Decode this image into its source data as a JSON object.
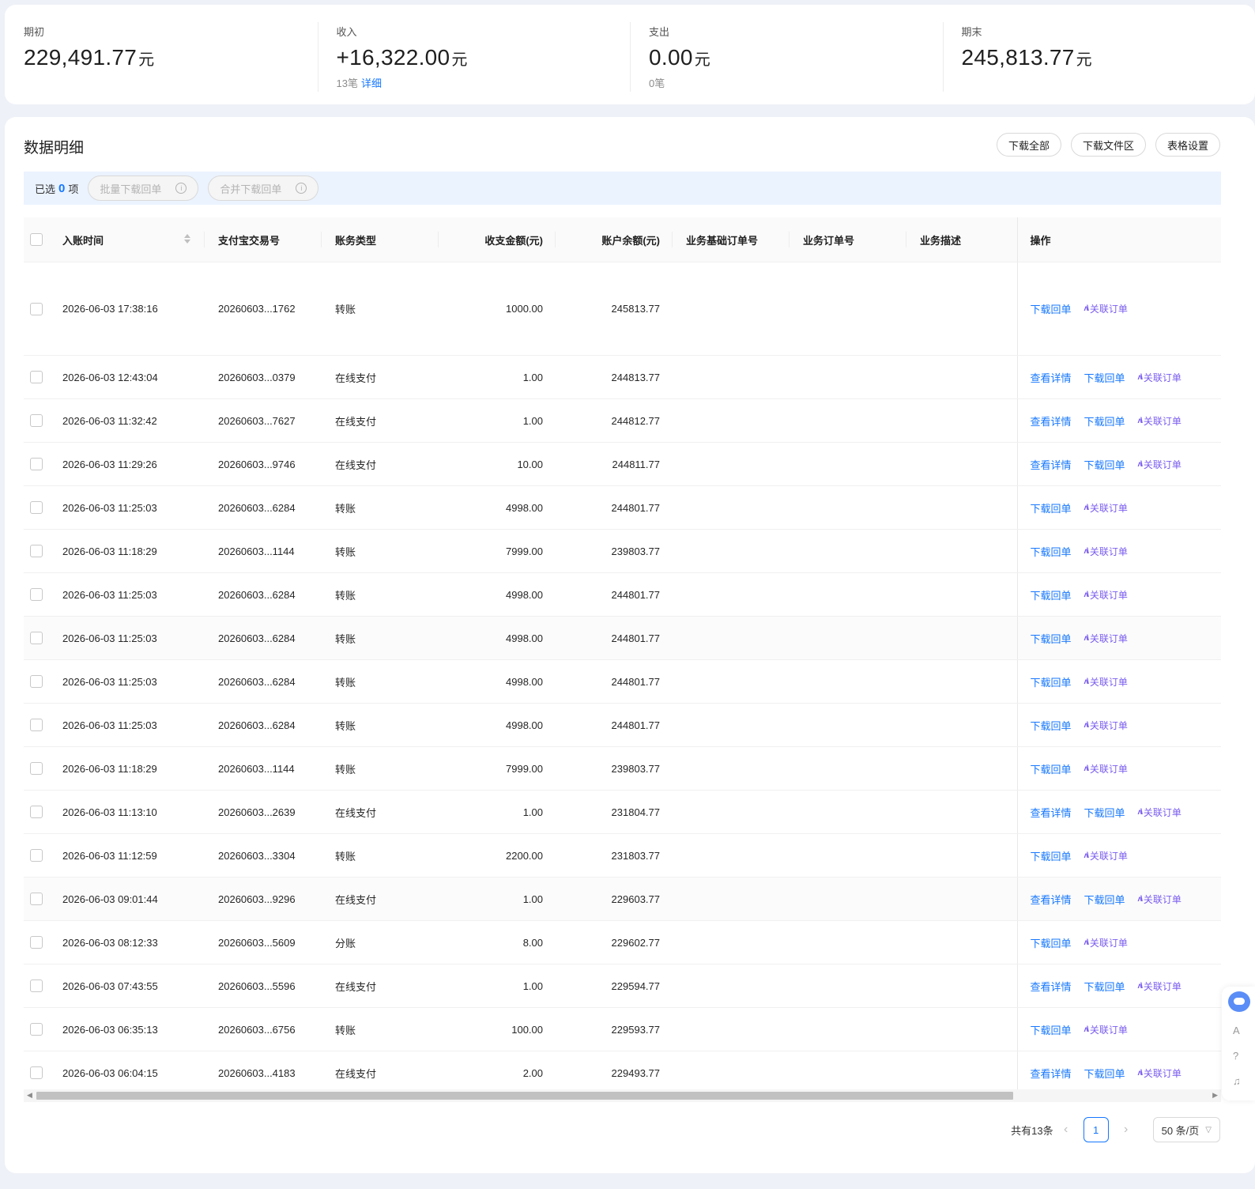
{
  "summary": {
    "opening": {
      "label": "期初",
      "value": "229,491.77",
      "unit": "元"
    },
    "income": {
      "label": "收入",
      "value": "+16,322.00",
      "unit": "元",
      "count": "13笔",
      "detail": "详细"
    },
    "expense": {
      "label": "支出",
      "value": "0.00",
      "unit": "元",
      "count": "0笔"
    },
    "closing": {
      "label": "期末",
      "value": "245,813.77",
      "unit": "元"
    }
  },
  "panel": {
    "title": "数据明细",
    "buttons": {
      "download_all": "下载全部",
      "download_area": "下载文件区",
      "table_settings": "表格设置"
    }
  },
  "selection": {
    "prefix": "已选",
    "count": "0",
    "suffix": "项",
    "batch_download": "批量下载回单",
    "merge_download": "合并下载回单"
  },
  "table": {
    "headers": {
      "time": "入账时间",
      "trade_no": "支付宝交易号",
      "type": "账务类型",
      "amount": "收支金额(元)",
      "balance": "账户余额(元)",
      "base_order": "业务基础订单号",
      "order": "业务订单号",
      "desc": "业务描述",
      "ops": "操作"
    },
    "actions": {
      "view": "查看详情",
      "download": "下载回单",
      "link": "关联订单"
    },
    "rows": [
      {
        "time": "2026-06-03 17:38:16",
        "trade_no": "20260603...1762",
        "type": "转账",
        "amount": "1000.00",
        "balance": "245813.77",
        "view": ""
      },
      {
        "time": "2026-06-03 12:43:04",
        "trade_no": "20260603...0379",
        "type": "在线支付",
        "amount": "1.00",
        "balance": "244813.77",
        "view": "查看详情"
      },
      {
        "time": "2026-06-03 11:32:42",
        "trade_no": "20260603...7627",
        "type": "在线支付",
        "amount": "1.00",
        "balance": "244812.77",
        "view": "查看详情"
      },
      {
        "time": "2026-06-03 11:29:26",
        "trade_no": "20260603...9746",
        "type": "在线支付",
        "amount": "10.00",
        "balance": "244811.77",
        "view": "查看详情"
      },
      {
        "time": "2026-06-03 11:25:03",
        "trade_no": "20260603...6284",
        "type": "转账",
        "amount": "4998.00",
        "balance": "244801.77",
        "view": ""
      },
      {
        "time": "2026-06-03 11:18:29",
        "trade_no": "20260603...1144",
        "type": "转账",
        "amount": "7999.00",
        "balance": "239803.77",
        "view": ""
      },
      {
        "time": "2026-06-03 11:25:03",
        "trade_no": "20260603...6284",
        "type": "转账",
        "amount": "4998.00",
        "balance": "244801.77",
        "view": ""
      },
      {
        "time": "2026-06-03 11:25:03",
        "trade_no": "20260603...6284",
        "type": "转账",
        "amount": "4998.00",
        "balance": "244801.77",
        "view": ""
      },
      {
        "time": "2026-06-03 11:25:03",
        "trade_no": "20260603...6284",
        "type": "转账",
        "amount": "4998.00",
        "balance": "244801.77",
        "view": ""
      },
      {
        "time": "2026-06-03 11:25:03",
        "trade_no": "20260603...6284",
        "type": "转账",
        "amount": "4998.00",
        "balance": "244801.77",
        "view": ""
      },
      {
        "time": "2026-06-03 11:18:29",
        "trade_no": "20260603...1144",
        "type": "转账",
        "amount": "7999.00",
        "balance": "239803.77",
        "view": ""
      },
      {
        "time": "2026-06-03 11:13:10",
        "trade_no": "20260603...2639",
        "type": "在线支付",
        "amount": "1.00",
        "balance": "231804.77",
        "view": "查看详情"
      },
      {
        "time": "2026-06-03 11:12:59",
        "trade_no": "20260603...3304",
        "type": "转账",
        "amount": "2200.00",
        "balance": "231803.77",
        "view": ""
      },
      {
        "time": "2026-06-03 09:01:44",
        "trade_no": "20260603...9296",
        "type": "在线支付",
        "amount": "1.00",
        "balance": "229603.77",
        "view": "查看详情"
      },
      {
        "time": "2026-06-03 08:12:33",
        "trade_no": "20260603...5609",
        "type": "分账",
        "amount": "8.00",
        "balance": "229602.77",
        "view": ""
      },
      {
        "time": "2026-06-03 07:43:55",
        "trade_no": "20260603...5596",
        "type": "在线支付",
        "amount": "1.00",
        "balance": "229594.77",
        "view": "查看详情"
      },
      {
        "time": "2026-06-03 06:35:13",
        "trade_no": "20260603...6756",
        "type": "转账",
        "amount": "100.00",
        "balance": "229593.77",
        "view": ""
      },
      {
        "time": "2026-06-03 06:04:15",
        "trade_no": "20260603...4183",
        "type": "在线支付",
        "amount": "2.00",
        "balance": "229493.77",
        "view": "查看详情"
      }
    ]
  },
  "pagination": {
    "total": "共有13条",
    "current": "1",
    "page_size": "50 条/页"
  }
}
